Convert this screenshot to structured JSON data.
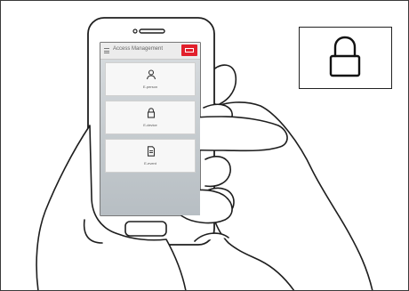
{
  "app": {
    "title": "Access Management"
  },
  "cards": [
    {
      "label": "E-person",
      "icon": "person-icon"
    },
    {
      "label": "E-device",
      "icon": "lock-icon"
    },
    {
      "label": "E-event",
      "icon": "document-icon"
    }
  ],
  "callout": {
    "icon": "lock-icon"
  },
  "colors": {
    "brand": "#e2202c",
    "line": "#222222"
  }
}
